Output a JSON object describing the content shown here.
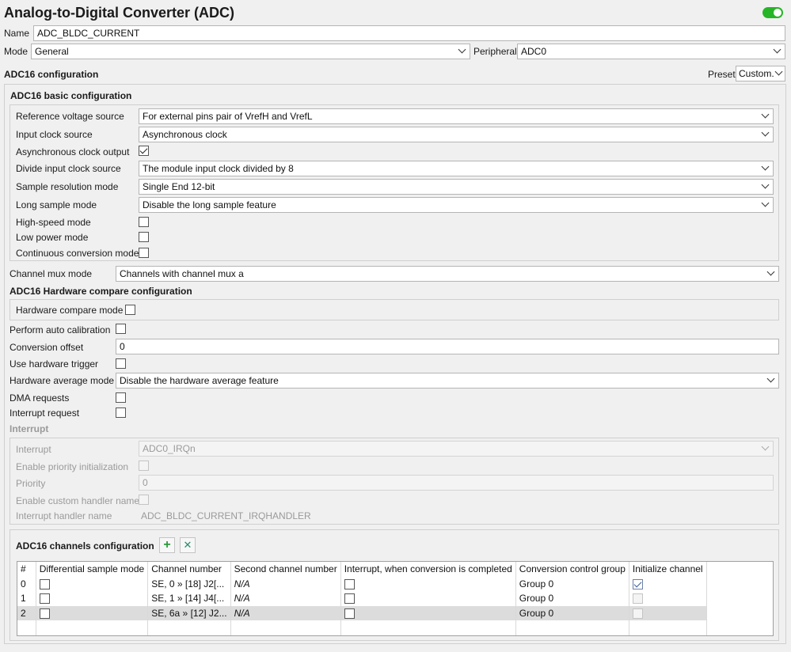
{
  "header": {
    "title": "Analog-to-Digital Converter (ADC)",
    "enabled": true,
    "toggle_color": "#26b526"
  },
  "name_field": {
    "label": "Name",
    "value": "ADC_BLDC_CURRENT"
  },
  "mode": {
    "label": "Mode",
    "value": "General"
  },
  "peripheral": {
    "label": "Peripheral",
    "value": "ADC0"
  },
  "adc16": {
    "title": "ADC16 configuration",
    "preset_label": "Preset",
    "preset_value": "Custom."
  },
  "basic": {
    "title": "ADC16 basic configuration",
    "ref_voltage": {
      "label": "Reference voltage source",
      "value": "For external pins pair of VrefH and VrefL"
    },
    "input_clock": {
      "label": "Input clock source",
      "value": "Asynchronous clock"
    },
    "async_output": {
      "label": "Asynchronous clock output",
      "checked": true
    },
    "divide_clock": {
      "label": "Divide input clock source",
      "value": "The module input clock divided by 8"
    },
    "sample_resolution": {
      "label": "Sample resolution mode",
      "value": "Single End 12-bit"
    },
    "long_sample": {
      "label": "Long sample mode",
      "value": "Disable the long sample feature"
    },
    "high_speed": {
      "label": "High-speed mode",
      "checked": false
    },
    "low_power": {
      "label": "Low power mode",
      "checked": false
    },
    "continuous": {
      "label": "Continuous conversion mode",
      "checked": false
    }
  },
  "channel_mux": {
    "label": "Channel mux mode",
    "value": "Channels with channel mux a"
  },
  "hw_compare": {
    "title": "ADC16 Hardware compare configuration",
    "mode": {
      "label": "Hardware compare mode",
      "checked": false
    }
  },
  "auto_cal": {
    "label": "Perform auto calibration",
    "checked": false
  },
  "conv_offset": {
    "label": "Conversion offset",
    "value": "0"
  },
  "hw_trigger": {
    "label": "Use hardware trigger",
    "checked": false
  },
  "hw_average": {
    "label": "Hardware average mode",
    "value": "Disable the hardware average feature"
  },
  "dma": {
    "label": "DMA requests",
    "checked": false
  },
  "irq_request": {
    "label": "Interrupt request",
    "checked": false
  },
  "interrupt": {
    "title": "Interrupt",
    "irq": {
      "label": "Interrupt",
      "value": "ADC0_IRQn"
    },
    "prio_init": {
      "label": "Enable priority initialization"
    },
    "priority": {
      "label": "Priority",
      "value": "0"
    },
    "custom_handler": {
      "label": "Enable custom handler name"
    },
    "handler_name": {
      "label": "Interrupt handler name",
      "value": "ADC_BLDC_CURRENT_IRQHANDLER"
    }
  },
  "channels": {
    "title": "ADC16 channels configuration",
    "add_icon": "+",
    "remove_icon": "✕",
    "columns": [
      "#",
      "Differential sample mode",
      "Channel number",
      "Second channel number",
      "Interrupt, when conversion is completed",
      "Conversion control group",
      "Initialize channel"
    ],
    "rows": [
      {
        "index": "0",
        "channel": "SE, 0 » [18] J2[...",
        "second": "N/A",
        "group": "Group 0",
        "init": true
      },
      {
        "index": "1",
        "channel": "SE, 1 » [14] J4[...",
        "second": "N/A",
        "group": "Group 0",
        "init": false
      },
      {
        "index": "2",
        "channel": "SE, 6a » [12] J2...",
        "second": "N/A",
        "group": "Group 0",
        "init": false
      }
    ]
  }
}
